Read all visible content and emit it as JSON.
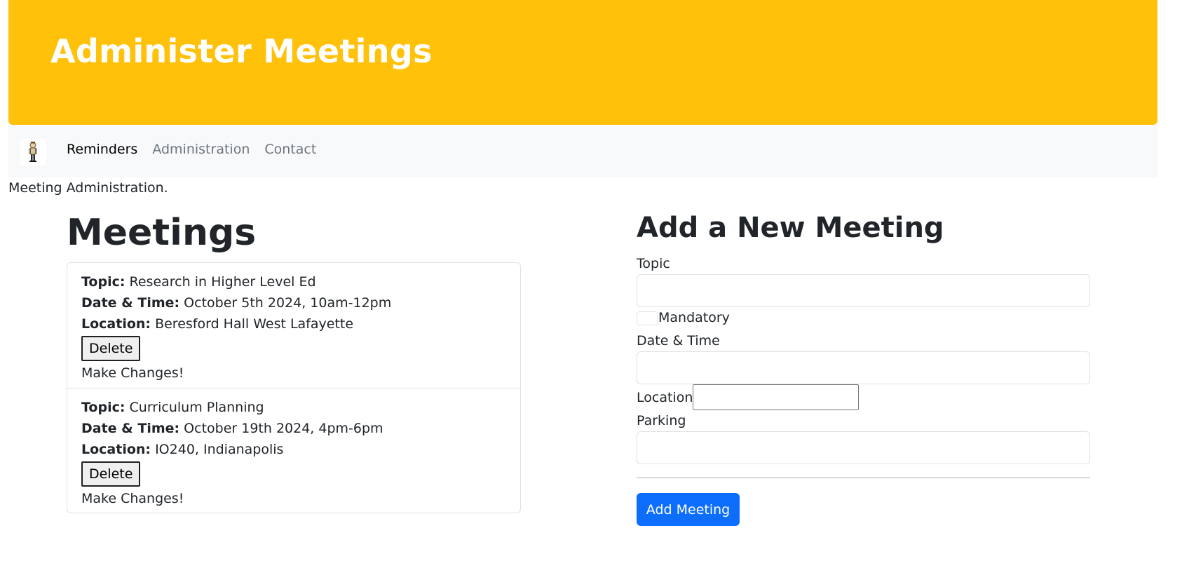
{
  "header": {
    "title": "Administer Meetings",
    "background_color": "#ffc10a"
  },
  "navbar": {
    "logo_icon": "person-figure-icon",
    "links": [
      {
        "label": "Reminders",
        "active": true
      },
      {
        "label": "Administration",
        "active": false
      },
      {
        "label": "Contact",
        "active": false
      }
    ]
  },
  "intro": {
    "text": "Meeting Administration."
  },
  "meetings": {
    "heading": "Meetings",
    "topic_label": "Topic:",
    "datetime_label": "Date & Time:",
    "location_label": "Location:",
    "delete_label": "Delete",
    "changes_label": "Make Changes!",
    "items": [
      {
        "topic": "Research in Higher Level Ed",
        "datetime": "October 5th 2024, 10am-12pm",
        "location": "Beresford Hall West Lafayette"
      },
      {
        "topic": "Curriculum Planning",
        "datetime": "October 19th 2024, 4pm-6pm",
        "location": "IO240, Indianapolis"
      }
    ]
  },
  "form": {
    "heading": "Add a New Meeting",
    "topic_label": "Topic",
    "topic_value": "",
    "mandatory_label": "Mandatory",
    "mandatory_checked": false,
    "datetime_label": "Date & Time",
    "datetime_value": "",
    "location_label": "Location",
    "location_value": "",
    "parking_label": "Parking",
    "parking_value": "",
    "submit_label": "Add Meeting",
    "submit_color": "#0d6efd"
  }
}
